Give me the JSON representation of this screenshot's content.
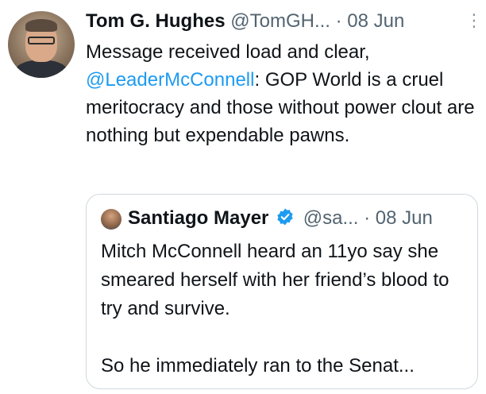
{
  "tweet": {
    "author_name": "Tom G. Hughes",
    "author_handle": "@TomGH...",
    "separator": "·",
    "date": "08 Jun",
    "more_icon": "more-dots-icon",
    "text_before_mention": "Message received load and clear,",
    "mention": "@LeaderMcConnell",
    "text_after_mention": ": GOP World is a cruel meritocracy and those without power clout are nothing but expendable pawns."
  },
  "quote": {
    "author_name": "Santiago Mayer",
    "author_handle": "@sa...",
    "separator": "·",
    "date": "08 Jun",
    "verified_icon": "verified-badge-icon",
    "paragraph_1": "Mitch McConnell heard an 11yo say she smeared herself with her friend’s blood to try and survive.",
    "paragraph_2": "So he immediately ran to the Senat..."
  },
  "colors": {
    "link": "#1d9bf0",
    "text": "#0f1419",
    "muted": "#536471",
    "border": "#cfd9de"
  }
}
